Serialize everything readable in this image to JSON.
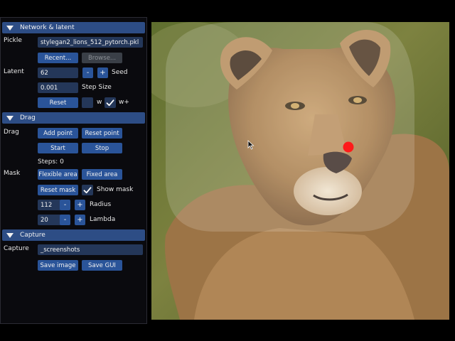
{
  "sections": {
    "network": "Network & latent",
    "drag": "Drag",
    "capture": "Capture"
  },
  "network": {
    "pickle_label": "Pickle",
    "pickle_value": "stylegan2_lions_512_pytorch.pkl",
    "recent_label": "Recent...",
    "browse_label": "Browse...",
    "latent_label": "Latent",
    "seed_value": "62",
    "minus_label": "-",
    "plus_label": "+",
    "seed_label": "Seed",
    "step_size_value": "0.001",
    "step_size_label": "Step Size",
    "reset_label": "Reset",
    "w_label": "w",
    "w_checked": false,
    "wplus_label": "w+",
    "wplus_checked": true
  },
  "drag": {
    "drag_label": "Drag",
    "add_point_label": "Add point",
    "reset_point_label": "Reset point",
    "start_label": "Start",
    "stop_label": "Stop",
    "steps_text": "Steps: 0",
    "mask_label": "Mask",
    "flexible_area_label": "Flexible area",
    "fixed_area_label": "Fixed area",
    "reset_mask_label": "Reset mask",
    "show_mask_label": "Show mask",
    "show_mask_checked": true,
    "radius_value": "112",
    "radius_label": "Radius",
    "lambda_value": "20",
    "lambda_label": "Lambda",
    "minus_label": "-",
    "plus_label": "+"
  },
  "capture": {
    "capture_label": "Capture",
    "path_value": "_screenshots",
    "save_image_label": "Save image",
    "save_gui_label": "Save GUI"
  },
  "colors": {
    "section_header": "#2d4d85",
    "button": "#2a5499",
    "field": "#243759",
    "drag_point": "#ff1a1a"
  }
}
